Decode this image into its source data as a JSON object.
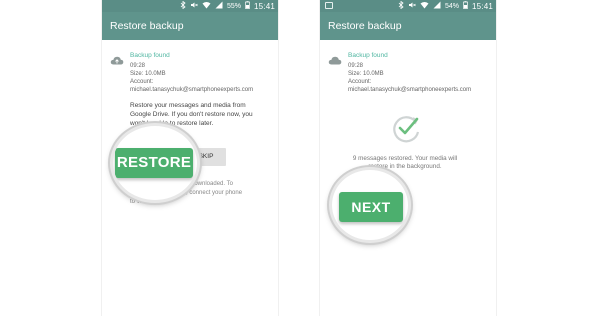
{
  "screens": [
    {
      "status": {
        "battery": "55%",
        "time": "15:41"
      },
      "app_title": "Restore backup",
      "backup": {
        "title": "Backup found",
        "time": "09:28",
        "size": "Size: 10.0MB",
        "account_label": "Account:",
        "account": "michael.tanasychuk@smartphoneexperts.com"
      },
      "description_lines": [
        "Restore your messages and media from",
        "Google Drive. If you don't restore now, you",
        "won't be able to restore later."
      ],
      "restore_button": "RESTORE",
      "skip_button": "SKIP",
      "footer_lines": [
        "e downloaded. To",
        "age, connect your phone",
        "to Wi-Fi."
      ]
    },
    {
      "status": {
        "battery": "54%",
        "time": "15:41"
      },
      "app_title": "Restore backup",
      "backup": {
        "title": "Backup found",
        "time": "09:28",
        "size": "Size: 10.0MB",
        "account_label": "Account:",
        "account": "michael.tanasychuk@smartphoneexperts.com"
      },
      "restored_lines": [
        "9 messages restored. Your media will",
        "restore in the background."
      ],
      "next_button": "NEXT"
    }
  ],
  "icons": {
    "cloud": "cloud-icon",
    "check": "check-circle-icon",
    "bluetooth": "bluetooth-icon",
    "mute": "mute-icon",
    "wifi": "wifi-icon",
    "signal": "signal-icon",
    "battery": "battery-icon"
  },
  "colors": {
    "app_bar": "#5f948c",
    "status_bar": "#5a8d86",
    "accent": "#4fb6a1",
    "button_green": "#4caf6e"
  }
}
